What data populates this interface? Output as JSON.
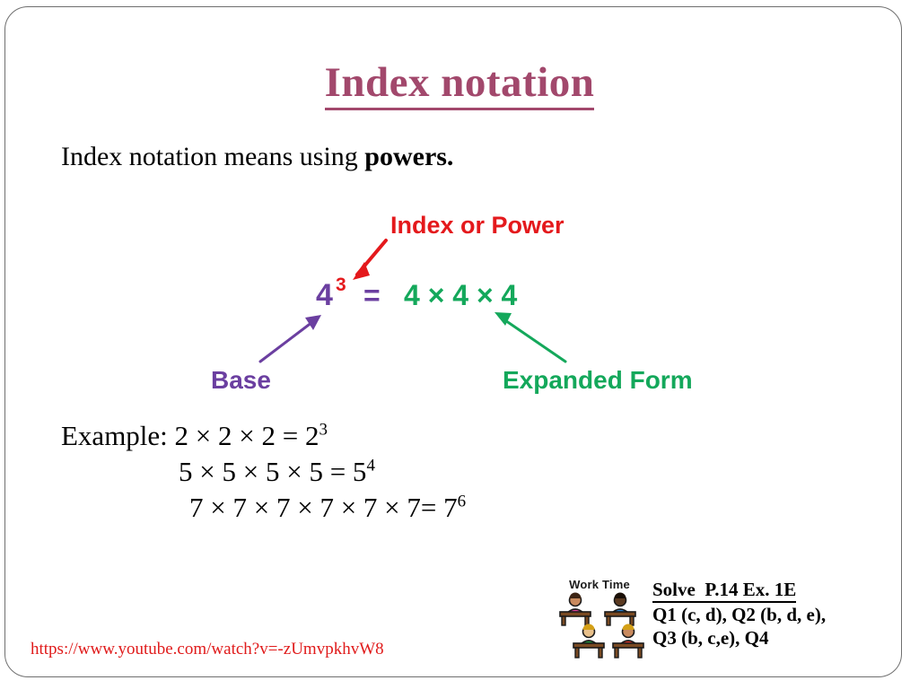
{
  "slide": {
    "title": "Index notation",
    "title_color": "#a2486c",
    "background": "#ffffff",
    "border_color": "#6f6f6f"
  },
  "lead": {
    "text_plain": "Index notation means using ",
    "text_bold": "powers."
  },
  "diagram": {
    "alt": "index-notation-clipart",
    "index_label": "Index or Power",
    "index_label_color": "#e4191c",
    "base_label": "Base",
    "base_label_color": "#6b3fa0",
    "expanded_label": "Expanded Form",
    "expanded_label_color": "#14a85b",
    "expression": {
      "base": "4",
      "exponent": "3",
      "equals": "=",
      "expansion": "4 × 4 × 4",
      "base_color": "#6b3fa0",
      "exponent_color": "#e4191c",
      "equals_color": "#6b3fa0",
      "expansion_color": "#14a85b"
    },
    "arrows": [
      {
        "name": "index-arrow",
        "color": "#e4191c",
        "points_to": "exponent"
      },
      {
        "name": "base-arrow",
        "color": "#6b3fa0",
        "points_to": "base"
      },
      {
        "name": "expanded-arrow",
        "color": "#14a85b",
        "points_to": "expansion"
      }
    ]
  },
  "examples": {
    "label": "Example:",
    "rows": [
      {
        "expression": "2 × 2 × 2 = 2",
        "exponent": "3"
      },
      {
        "expression": "5 × 5 × 5 × 5 = 5",
        "exponent": "4"
      },
      {
        "expression": "7 × 7 × 7 × 7 × 7 × 7= 7",
        "exponent": "6"
      }
    ]
  },
  "worktime": {
    "caption": "Work Time",
    "students": [
      {
        "shirt": "#e0429a",
        "skin": "#c98a5e",
        "hair": "#3d2414"
      },
      {
        "shirt": "#2a7fc9",
        "skin": "#5b3a21",
        "hair": "#1a1008"
      },
      {
        "shirt": "#1f9e3e",
        "skin": "#e8c08a",
        "hair": "#d4a017"
      },
      {
        "shirt": "#e03428",
        "skin": "#c98a5e",
        "hair": "#d4a017"
      }
    ],
    "desk_color": "#7a4a22"
  },
  "homework": {
    "title": "Solve  P.14 Ex. 1E",
    "lines": [
      "Q1 (c, d), Q2 (b, d, e),",
      "Q3 (b, c,e), Q4"
    ]
  },
  "link": {
    "url": "https://www.youtube.com/watch?v=-zUmvpkhvW8",
    "color": "#e01b1b"
  }
}
